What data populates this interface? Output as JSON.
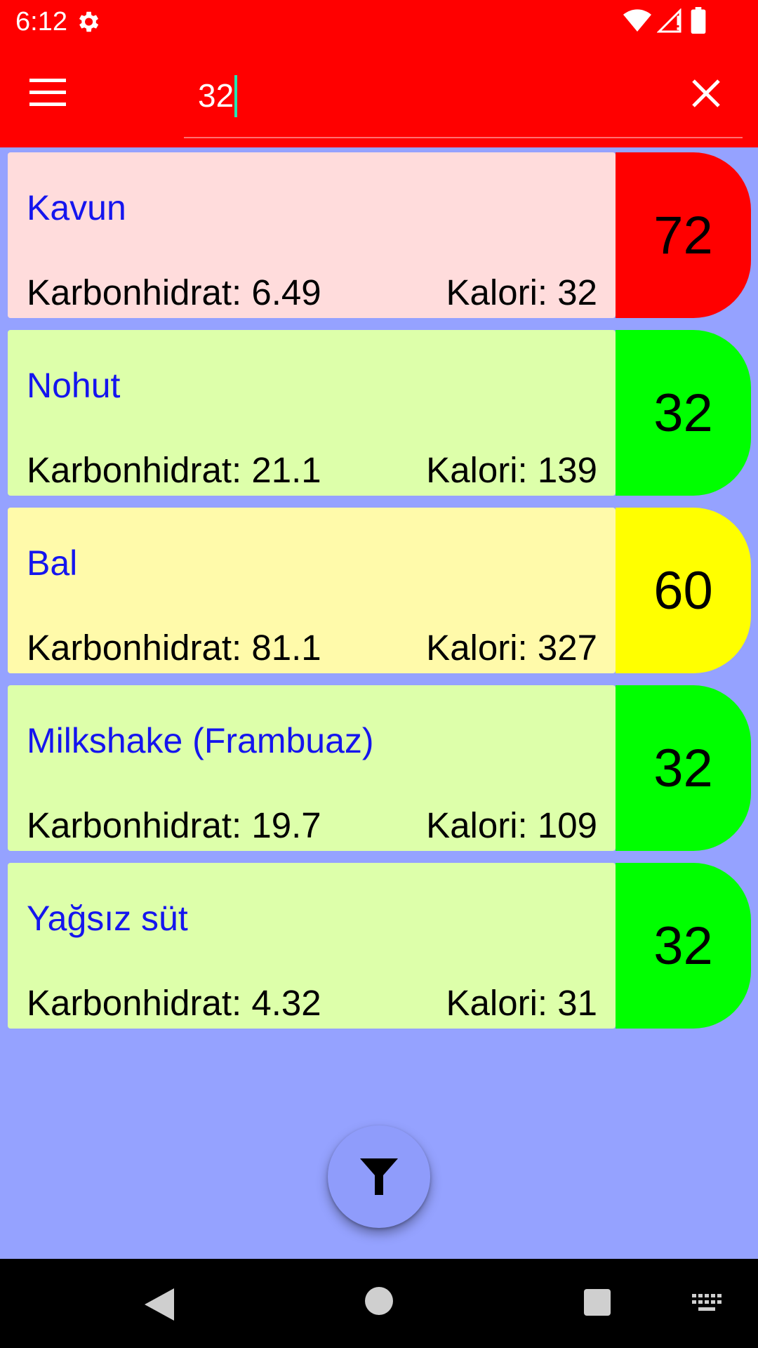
{
  "status_bar": {
    "time": "6:12",
    "icons": [
      "gear-icon",
      "wifi-icon",
      "signal-icon",
      "battery-icon"
    ]
  },
  "app_bar": {
    "background": "#ff0000",
    "search": {
      "value": "32",
      "placeholder": ""
    },
    "icons": [
      "menu-icon",
      "close-icon"
    ]
  },
  "colors": {
    "background": "#95a2ff",
    "name_text": "#1515ee",
    "high": "#ff0000",
    "medium": "#ffff00",
    "low": "#00ff00"
  },
  "items": [
    {
      "name": "Kavun",
      "carb": "Karbonhidrat: 6.49",
      "cal": "Kalori: 32",
      "gi": "72",
      "body_color": "#ffdcdc",
      "badge_color": "#ff0000"
    },
    {
      "name": "Nohut",
      "carb": "Karbonhidrat: 21.1",
      "cal": "Kalori: 139",
      "gi": "32",
      "body_color": "#ddffaa",
      "badge_color": "#00ff00"
    },
    {
      "name": "Bal",
      "carb": "Karbonhidrat: 81.1",
      "cal": "Kalori: 327",
      "gi": "60",
      "body_color": "#fffaaa",
      "badge_color": "#ffff00"
    },
    {
      "name": "Milkshake (Frambuaz)",
      "carb": "Karbonhidrat: 19.7",
      "cal": "Kalori: 109",
      "gi": "32",
      "body_color": "#ddffaa",
      "badge_color": "#00ff00"
    },
    {
      "name": "Yağsız süt",
      "carb": "Karbonhidrat: 4.32",
      "cal": "Kalori: 31",
      "gi": "32",
      "body_color": "#ddffaa",
      "badge_color": "#00ff00"
    }
  ],
  "fab": {
    "icon": "filter-icon"
  },
  "nav_bar": {
    "icons": [
      "back-icon",
      "home-icon",
      "recents-icon",
      "keyboard-icon"
    ]
  }
}
